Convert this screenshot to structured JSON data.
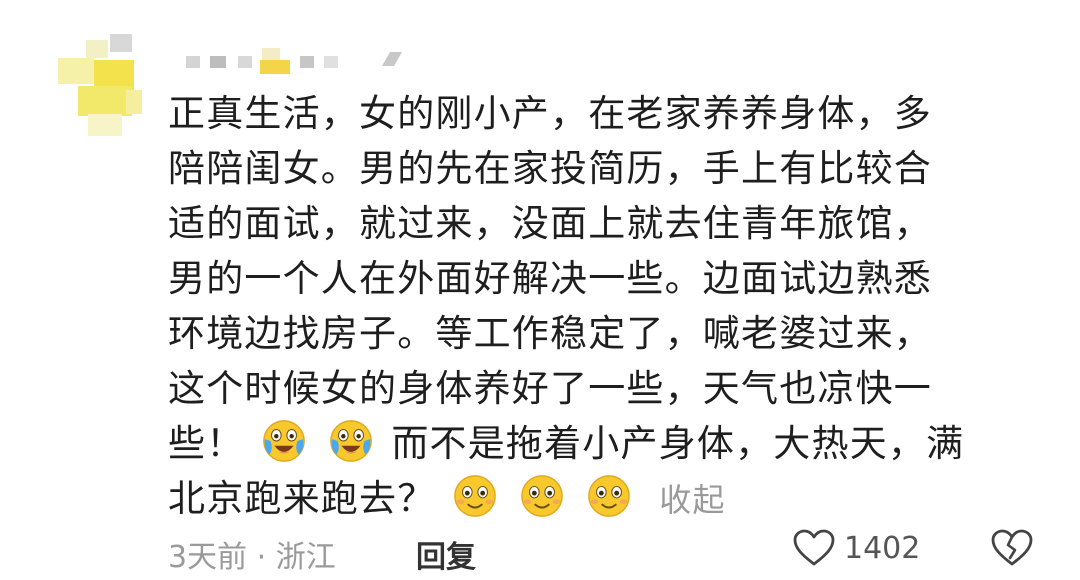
{
  "comment": {
    "lines": [
      "正真生活，女的刚小产，在老家养养身体，多",
      "陪陪闺女。男的先在家投简历，手上有比较合",
      "适的面试，就过来，没面上就去住青年旅馆，",
      "男的一个人在外面好解决一些。边面试边熟悉",
      "环境边找房子。等工作稳定了，喊老婆过来，",
      "这个时候女的身体养好了一些，天气也凉快一"
    ],
    "line7_before": "些！",
    "line7_after": "而不是拖着小产身体，大热天，满",
    "line8_text": "北京跑来跑去？",
    "collapse_label": "收起"
  },
  "meta": {
    "time_location": "3天前 · 浙江",
    "reply_label": "回复",
    "like_count": "1402"
  },
  "icons": {
    "crying_emoji": "crying-laughing-emoji",
    "smile_emoji": "smiling-emoji",
    "like": "heart-outline-icon",
    "dislike": "broken-heart-icon"
  },
  "colors": {
    "text": "#1e1e1e",
    "muted": "#9a9a9a",
    "emoji_yellow": "#f8c92c"
  }
}
